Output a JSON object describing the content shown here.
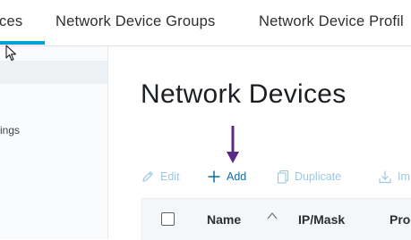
{
  "tabs": [
    {
      "label": "ces",
      "active": true
    },
    {
      "label": "Network Device Groups",
      "active": false
    },
    {
      "label": "Network Device Profil",
      "active": false
    }
  ],
  "sidebar": {
    "items": [
      {
        "label": "",
        "selected": true
      },
      {
        "label": "ings",
        "selected": false
      }
    ]
  },
  "main": {
    "title": "Network Devices",
    "toolbar": {
      "edit": {
        "label": "Edit",
        "icon": "pencil-icon",
        "enabled": false
      },
      "add": {
        "label": "Add",
        "icon": "plus-icon",
        "enabled": true
      },
      "duplicate": {
        "label": "Duplicate",
        "icon": "copy-icon",
        "enabled": false
      },
      "import": {
        "label": "Im",
        "icon": "import-icon",
        "enabled": false
      }
    },
    "table": {
      "columns": [
        "Name",
        "IP/Mask",
        "Pro"
      ],
      "sort_column": "Name",
      "sort_direction": "ascending"
    }
  },
  "annotation": {
    "type": "arrow-down",
    "color": "#5b2a86"
  },
  "colors": {
    "accent": "#049fd9",
    "link_enabled": "#0b6ea8",
    "link_disabled": "#9cc7e4"
  }
}
